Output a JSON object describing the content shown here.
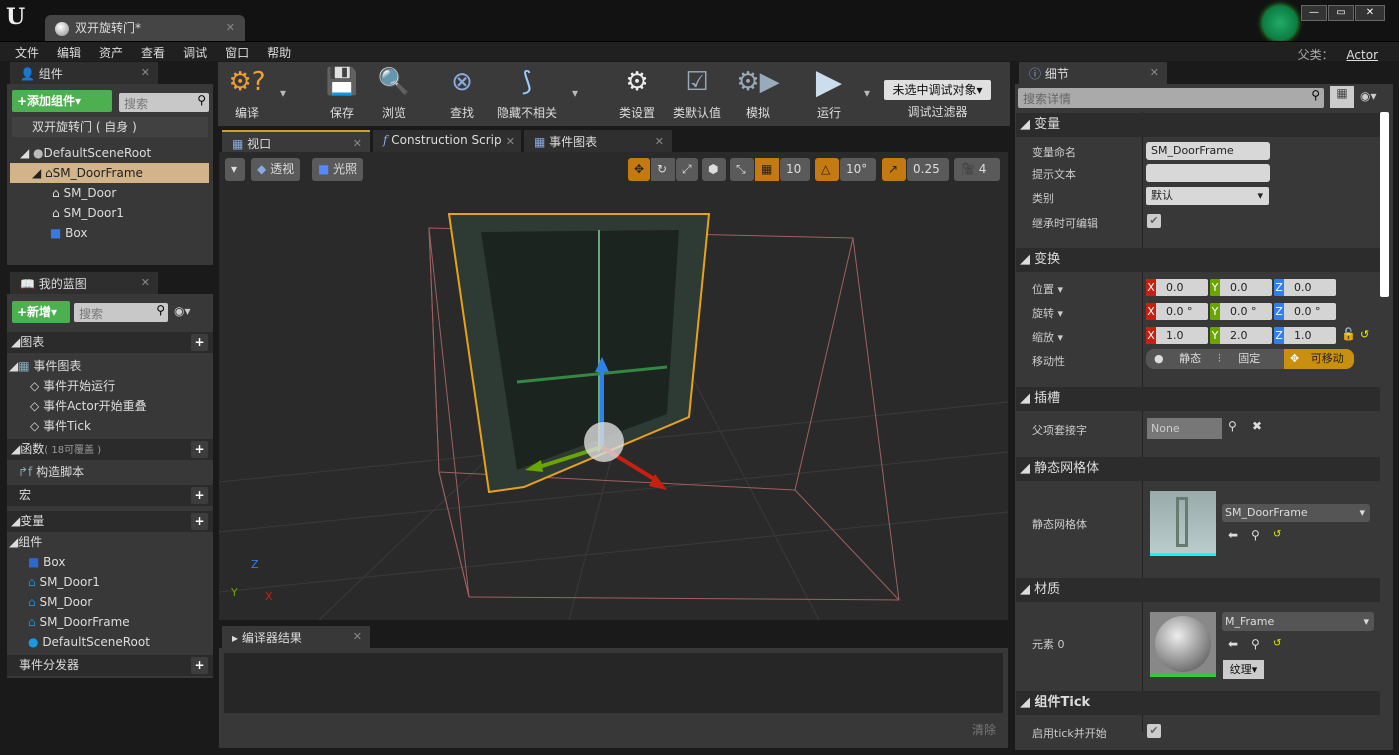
{
  "window": {
    "doc_tab": "双开旋转门*",
    "controls": [
      "—",
      "▭",
      "✕"
    ]
  },
  "menu": [
    "文件",
    "编辑",
    "资产",
    "查看",
    "调试",
    "窗口",
    "帮助"
  ],
  "parent_class": {
    "label": "父类：",
    "value": "Actor"
  },
  "components_panel": {
    "tab": "组件",
    "add_button": "+添加组件▾",
    "search_placeholder": "搜索",
    "self": "双开旋转门 ( 自身 )",
    "tree": [
      "DefaultSceneRoot",
      "SM_DoorFrame",
      "SM_Door",
      "SM_Door1",
      "Box"
    ]
  },
  "my_blueprint": {
    "tab": "我的蓝图",
    "new_button": "+新增▾",
    "search_placeholder": "搜索",
    "graphs": "图表",
    "event_graph": "事件图表",
    "events": [
      "事件开始运行",
      "事件Actor开始重叠",
      "事件Tick"
    ],
    "functions": "函数",
    "functions_note": "( 18可覆盖 )",
    "construction": "构造脚本",
    "macros": "宏",
    "variables": "变量",
    "components": "组件",
    "component_vars": [
      "Box",
      "SM_Door1",
      "SM_Door",
      "SM_DoorFrame",
      "DefaultSceneRoot"
    ],
    "dispatchers": "事件分发器"
  },
  "toolbar": {
    "compile": "编译",
    "save": "保存",
    "browse": "浏览",
    "find": "查找",
    "hide_unrelated": "隐藏不相关",
    "class_settings": "类设置",
    "class_defaults": "类默认值",
    "simulate": "模拟",
    "play": "运行",
    "debug_object": "未选中调试对象▾",
    "debug_filter": "调试过滤器"
  },
  "editor_tabs": [
    "视口",
    "Construction Scrip",
    "事件图表"
  ],
  "viewport": {
    "perspective": "透视",
    "lit": "光照",
    "grid_snap": "10",
    "rot_snap": "10°",
    "scale_snap": "0.25",
    "cam_speed": "4",
    "axis": {
      "x": "X",
      "y": "Y",
      "z": "Z"
    }
  },
  "compiler": {
    "tab": "编译器结果",
    "clear": "清除"
  },
  "details": {
    "tab": "细节",
    "search_placeholder": "搜索详情",
    "variable": {
      "title": "变量",
      "name_label": "变量命名",
      "name_value": "SM_DoorFrame",
      "tooltip_label": "提示文本",
      "category_label": "类别",
      "category_value": "默认",
      "inherit_label": "继承时可编辑"
    },
    "transform": {
      "title": "变换",
      "location": "位置 ▾",
      "rotation": "旋转 ▾",
      "scale": "缩放 ▾",
      "loc": [
        "0.0",
        "0.0",
        "0.0"
      ],
      "rot": [
        "0.0 °",
        "0.0 °",
        "0.0 °"
      ],
      "scl": [
        "1.0",
        "2.0",
        "1.0"
      ],
      "mobility_label": "移动性",
      "mobility": [
        "静态",
        "固定",
        "可移动"
      ],
      "mobility_selected": "可移动"
    },
    "sockets": {
      "title": "插槽",
      "parent_socket": "父项套接字",
      "value": "None"
    },
    "static_mesh": {
      "title": "静态网格体",
      "label": "静态网格体",
      "value": "SM_DoorFrame"
    },
    "materials": {
      "title": "材质",
      "element": "元素 0",
      "value": "M_Frame",
      "textures": "纹理▾"
    },
    "tick": {
      "title": "组件Tick",
      "start": "启用tick并开始"
    }
  },
  "colors": {
    "accent": "#c47a10",
    "x": "#c8200e",
    "y": "#6aa600",
    "z": "#2f80ed",
    "selected": "#d3b38a",
    "green": "#4caf50"
  }
}
